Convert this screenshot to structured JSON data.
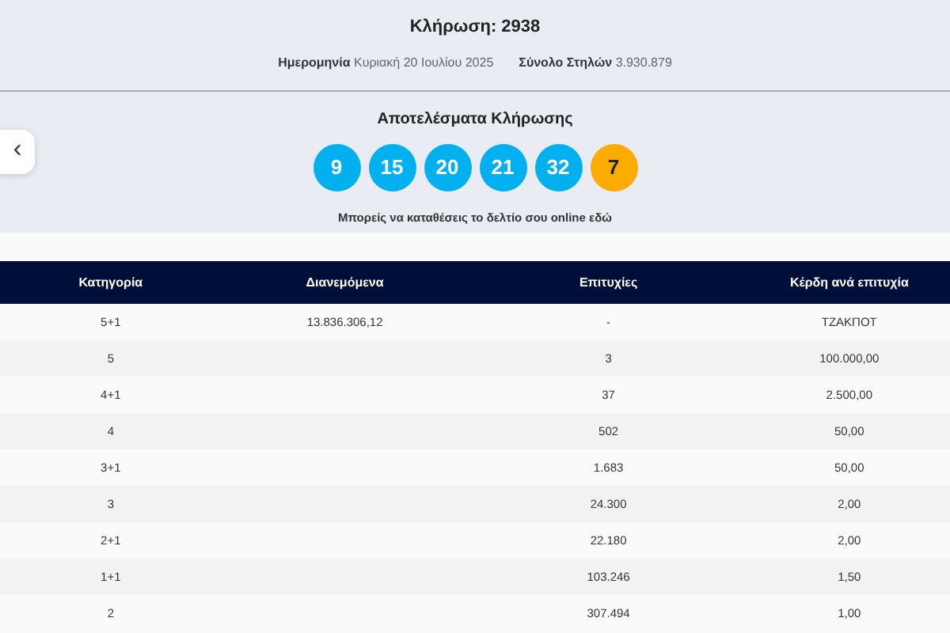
{
  "draw": {
    "title": "Κλήρωση: 2938",
    "date_label": "Ημερομηνία",
    "date": "Κυριακή 20 Ιουλίου 2025",
    "total_label": "Σύνολο Στηλών",
    "total": "3.930.879"
  },
  "results": {
    "heading": "Αποτελέσματα Κλήρωσης",
    "balls": [
      {
        "number": "9",
        "kind": "main"
      },
      {
        "number": "15",
        "kind": "main"
      },
      {
        "number": "20",
        "kind": "main"
      },
      {
        "number": "21",
        "kind": "main"
      },
      {
        "number": "32",
        "kind": "main"
      },
      {
        "number": "7",
        "kind": "bonus"
      }
    ],
    "note": "Μπορείς να καταθέσεις το δελτίο σου online εδώ"
  },
  "prev_button": {
    "label": "‹"
  },
  "table": {
    "columns": [
      "Κατηγορία",
      "Διανεμόμενα",
      "Επιτυχίες",
      "Κέρδη ανά επιτυχία"
    ],
    "rows": [
      [
        "5+1",
        "13.836.306,12",
        "-",
        "ΤΖΑΚΠΟΤ"
      ],
      [
        "5",
        "",
        "3",
        "100.000,00"
      ],
      [
        "4+1",
        "",
        "37",
        "2.500,00"
      ],
      [
        "4",
        "",
        "502",
        "50,00"
      ],
      [
        "3+1",
        "",
        "1.683",
        "50,00"
      ],
      [
        "3",
        "",
        "24.300",
        "2,00"
      ],
      [
        "2+1",
        "",
        "22.180",
        "2,00"
      ],
      [
        "1+1",
        "",
        "103.246",
        "1,50"
      ],
      [
        "2",
        "",
        "307.494",
        "1,00"
      ]
    ]
  }
}
